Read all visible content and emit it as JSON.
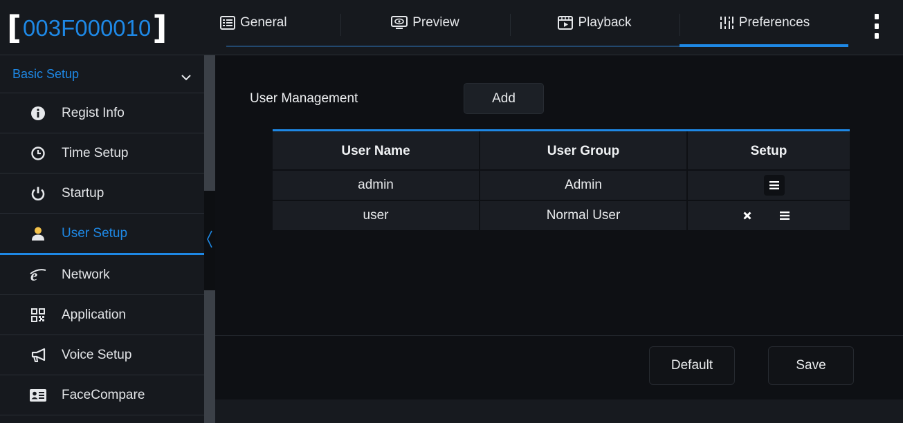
{
  "header": {
    "device_id": "003F000010",
    "tabs": [
      {
        "label": "General",
        "icon": "list-icon"
      },
      {
        "label": "Preview",
        "icon": "monitor-eye-icon"
      },
      {
        "label": "Playback",
        "icon": "play-window-icon"
      },
      {
        "label": "Preferences",
        "icon": "sliders-icon"
      }
    ],
    "active_tab": "Preferences",
    "more_icon": "vertical-dots-icon"
  },
  "sidebar": {
    "section": "Basic Setup",
    "items": [
      {
        "label": "Regist Info",
        "icon": "info-icon"
      },
      {
        "label": "Time Setup",
        "icon": "clock-icon"
      },
      {
        "label": "Startup",
        "icon": "power-icon"
      },
      {
        "label": "User Setup",
        "icon": "user-icon"
      },
      {
        "label": "Network",
        "icon": "internet-icon"
      },
      {
        "label": "Application",
        "icon": "qr-code-icon"
      },
      {
        "label": "Voice Setup",
        "icon": "megaphone-icon"
      },
      {
        "label": "FaceCompare",
        "icon": "id-card-icon"
      }
    ],
    "active_item": "User Setup"
  },
  "main": {
    "title": "User Management",
    "add_label": "Add",
    "table": {
      "headers": [
        "User Name",
        "User Group",
        "Setup"
      ],
      "rows": [
        {
          "name": "admin",
          "group": "Admin",
          "actions": [
            "menu-icon"
          ]
        },
        {
          "name": "user",
          "group": "Normal User",
          "actions": [
            "delete-icon",
            "menu-icon"
          ]
        }
      ]
    },
    "default_label": "Default",
    "save_label": "Save"
  },
  "colors": {
    "accent": "#1e88e5",
    "background": "#0e1014",
    "panel": "#16191e"
  }
}
